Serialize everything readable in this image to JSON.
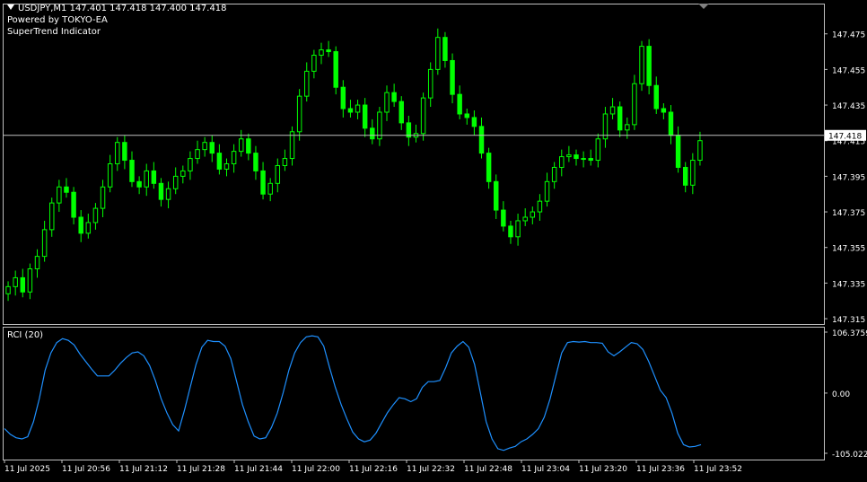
{
  "header": {
    "symbol_line": "USDJPY,M1  147.401 147.418 147.400 147.418",
    "powered_by": "Powered by TOKYO-EA",
    "indicator_name": "SuperTrend Indicator"
  },
  "rci_panel": {
    "label": "RCI (20)"
  },
  "colors": {
    "candle": "#00ff00",
    "rci_line": "#1e90ff",
    "frame": "#c0c0c0",
    "background": "#000000"
  },
  "chart_data": [
    {
      "type": "candlestick",
      "symbol": "USDJPY",
      "timeframe": "M1",
      "current_price": 147.418,
      "current_price_label": "147.418",
      "ylim": [
        147.312,
        147.492
      ],
      "y_tick_labels": [
        "147.475",
        "147.455",
        "147.435",
        "147.415",
        "147.395",
        "147.375",
        "147.355",
        "147.335",
        "147.315"
      ],
      "y_ticks": [
        147.475,
        147.455,
        147.435,
        147.415,
        147.395,
        147.375,
        147.355,
        147.335,
        147.315
      ],
      "close_series": [
        147.333,
        147.338,
        147.33,
        147.343,
        147.35,
        147.365,
        147.38,
        147.389,
        147.386,
        147.372,
        147.363,
        147.369,
        147.377,
        147.389,
        147.402,
        147.414,
        147.404,
        147.392,
        147.389,
        147.398,
        147.391,
        147.382,
        147.388,
        147.395,
        147.398,
        147.405,
        147.41,
        147.414,
        147.408,
        147.399,
        147.402,
        147.409,
        147.416,
        147.408,
        147.398,
        147.385,
        147.391,
        147.401,
        147.405,
        147.42,
        147.44,
        147.454,
        147.463,
        147.466,
        147.465,
        147.445,
        147.433,
        147.431,
        147.435,
        147.422,
        147.416,
        147.431,
        147.442,
        147.437,
        147.425,
        147.417,
        147.419,
        147.439,
        147.455,
        147.473,
        147.46,
        147.441,
        147.43,
        147.428,
        147.423,
        147.408,
        147.392,
        147.376,
        147.367,
        147.361,
        147.37,
        147.372,
        147.375,
        147.381,
        147.392,
        147.4,
        147.406,
        147.407,
        147.405,
        147.405,
        147.404,
        147.416,
        147.43,
        147.434,
        147.421,
        147.424,
        147.447,
        147.468,
        147.446,
        147.433,
        147.431,
        147.418,
        147.4,
        147.39,
        147.404,
        147.415
      ],
      "x_tick_labels": [
        "11 Jul 2025",
        "11 Jul 20:56",
        "11 Jul 21:12",
        "11 Jul 21:28",
        "11 Jul 21:44",
        "11 Jul 22:00",
        "11 Jul 22:16",
        "11 Jul 22:32",
        "11 Jul 22:48",
        "11 Jul 23:04",
        "11 Jul 23:20",
        "11 Jul 23:36",
        "11 Jul 23:52"
      ]
    },
    {
      "type": "line",
      "name": "RCI (20)",
      "ylim": [
        -105.0226,
        106.3759
      ],
      "y_ticks": [
        106.3759,
        0.0,
        -105.0226
      ],
      "y_tick_labels": [
        "106.3759",
        "0.00",
        "-105.0226"
      ],
      "values": [
        -62,
        -72,
        -78,
        -80,
        -76,
        -50,
        -10,
        40,
        70,
        88,
        95,
        92,
        84,
        68,
        55,
        42,
        30,
        30,
        30,
        40,
        52,
        62,
        70,
        72,
        65,
        48,
        22,
        -10,
        -35,
        -55,
        -66,
        -30,
        10,
        50,
        80,
        92,
        90,
        90,
        82,
        60,
        20,
        -20,
        -50,
        -75,
        -80,
        -78,
        -60,
        -35,
        0,
        40,
        70,
        88,
        98,
        100,
        98,
        82,
        45,
        10,
        -20,
        -45,
        -68,
        -80,
        -85,
        -82,
        -70,
        -52,
        -34,
        -20,
        -8,
        -10,
        -15,
        -10,
        10,
        20,
        20,
        22,
        44,
        70,
        82,
        90,
        80,
        50,
        0,
        -50,
        -80,
        -97,
        -100,
        -96,
        -93,
        -85,
        -80,
        -72,
        -62,
        -42,
        -10,
        30,
        70,
        88,
        90,
        89,
        90,
        88,
        88,
        87,
        72,
        65,
        72,
        80,
        88,
        86,
        76,
        55,
        30,
        5,
        -8,
        -35,
        -70,
        -90,
        -94,
        -93,
        -90
      ]
    }
  ]
}
